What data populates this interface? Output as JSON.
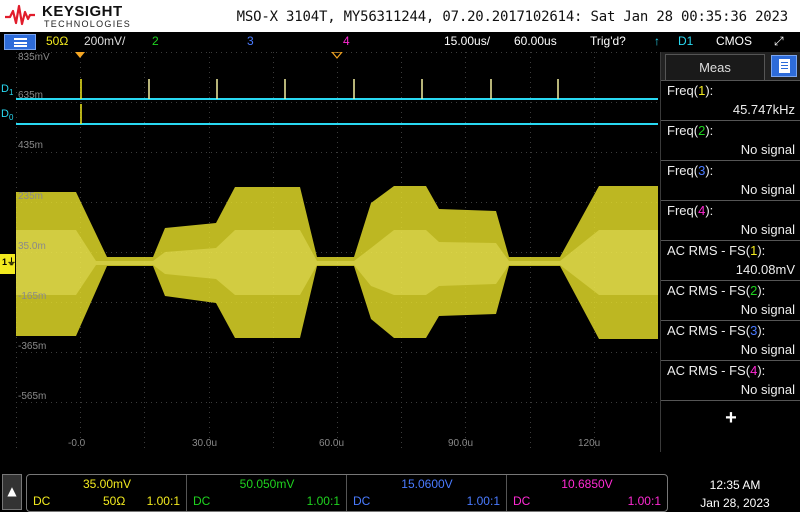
{
  "titlebar": {
    "brand": "KEYSIGHT",
    "brand_sub": "TECHNOLOGIES",
    "title": "MSO-X 3104T, MY56311244, 07.20.2017102614: Sat Jan 28 00:35:36 2023"
  },
  "channel_bar": {
    "ch1_impedance": "50Ω",
    "ch1_scale": "200mV/",
    "ch2_label": "2",
    "ch3_label": "3",
    "ch4_label": "4",
    "timebase": "15.00us/",
    "delay": "60.00us",
    "trigger_status": "Trig'd?",
    "trigger_source": "D1",
    "logic_threshold": "CMOS",
    "colors": {
      "ch1": "#f2ea1f",
      "ch2": "#1fd31f",
      "ch3": "#4a7bff",
      "ch4": "#ff2ad4",
      "digital": "#29d9f2"
    }
  },
  "graticule": {
    "y_labels": [
      "835mV",
      "635m",
      "435m",
      "235m",
      "35.0m",
      "-165m",
      "-365m",
      "-565m"
    ],
    "x_labels": [
      "-0.0",
      "30.0u",
      "60.0u",
      "90.0u",
      "120u"
    ],
    "digital_labels": [
      {
        "main": "D",
        "sub": "1"
      },
      {
        "main": "D",
        "sub": "0"
      }
    ],
    "ch1_marker": "1"
  },
  "meas_panel": {
    "tab_label": "Meas",
    "items": [
      {
        "name": "Freq",
        "channel": "1",
        "value": "45.747kHz"
      },
      {
        "name": "Freq",
        "channel": "2",
        "value": "No signal"
      },
      {
        "name": "Freq",
        "channel": "3",
        "value": "No signal"
      },
      {
        "name": "Freq",
        "channel": "4",
        "value": "No signal"
      },
      {
        "name": "AC RMS - FS",
        "channel": "1",
        "value": "140.08mV"
      },
      {
        "name": "AC RMS - FS",
        "channel": "2",
        "value": "No signal"
      },
      {
        "name": "AC RMS - FS",
        "channel": "3",
        "value": "No signal"
      },
      {
        "name": "AC RMS - FS",
        "channel": "4",
        "value": "No signal"
      }
    ],
    "add_label": "+"
  },
  "bottom_bar": {
    "channels": [
      {
        "scale": "35.00mV",
        "coupling": "DC",
        "impedance": "50Ω",
        "probe": "1.00:1",
        "color": "#f2ea1f"
      },
      {
        "scale": "50.050mV",
        "coupling": "DC",
        "impedance": "",
        "probe": "1.00:1",
        "color": "#1fd31f"
      },
      {
        "scale": "15.0600V",
        "coupling": "DC",
        "impedance": "",
        "probe": "1.00:1",
        "color": "#4a7bff"
      },
      {
        "scale": "10.6850V",
        "coupling": "DC",
        "impedance": "",
        "probe": "1.00:1",
        "color": "#ff2ad4"
      }
    ],
    "time": "12:35 AM",
    "date": "Jan 28, 2023"
  }
}
